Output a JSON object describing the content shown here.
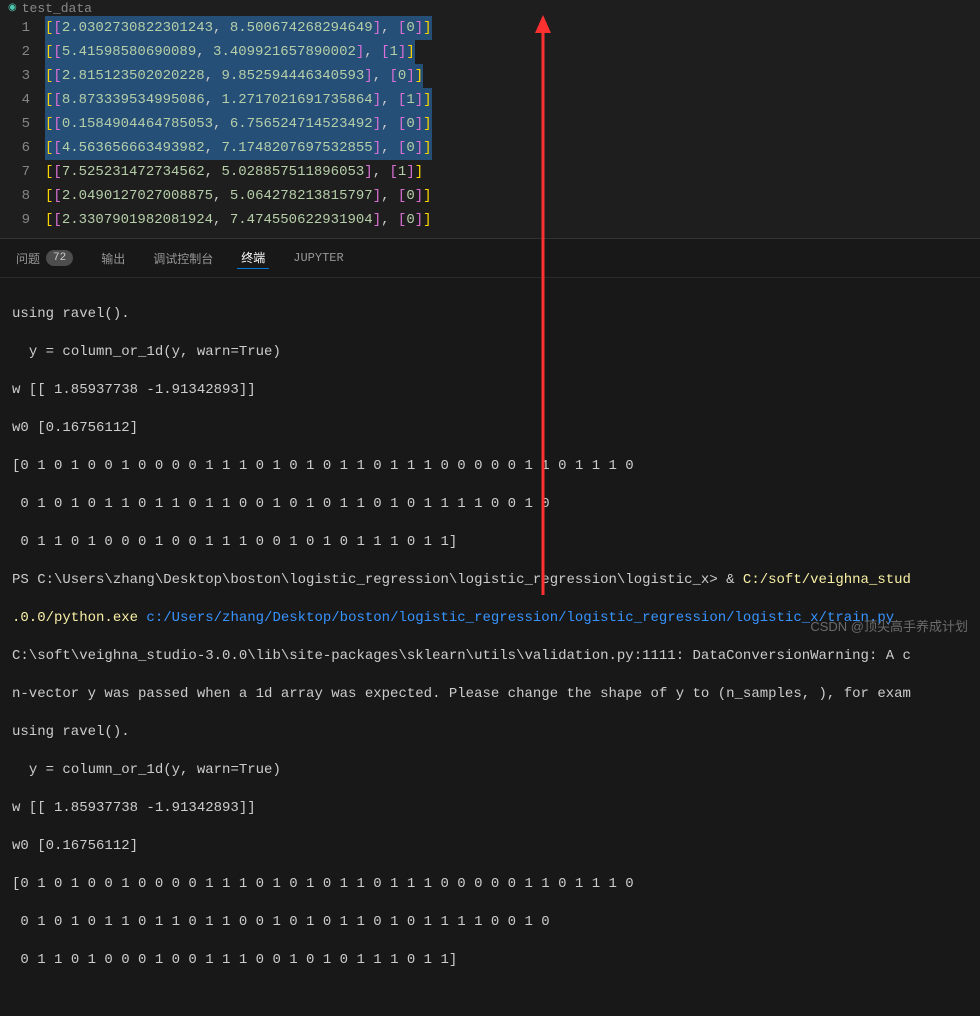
{
  "tab_title": "test_data",
  "lines": [
    {
      "num": 1,
      "sel": true,
      "a": "2.0302730822301243",
      "b": "8.500674268294649",
      "label": "0"
    },
    {
      "num": 2,
      "sel": true,
      "a": "5.41598580690089",
      "b": "3.409921657890002",
      "label": "1"
    },
    {
      "num": 3,
      "sel": true,
      "a": "2.815123502020228",
      "b": "9.852594446340593",
      "label": "0"
    },
    {
      "num": 4,
      "sel": true,
      "a": "8.873339534995086",
      "b": "1.2717021691735864",
      "label": "1"
    },
    {
      "num": 5,
      "sel": true,
      "a": "0.1584904464785053",
      "b": "6.756524714523492",
      "label": "0"
    },
    {
      "num": 6,
      "sel": true,
      "a": "4.563656663493982",
      "b": "7.1748207697532855",
      "label": "0"
    },
    {
      "num": 7,
      "sel": false,
      "a": "7.525231472734562",
      "b": "5.028857511896053",
      "label": "1"
    },
    {
      "num": 8,
      "sel": false,
      "a": "2.0490127027008875",
      "b": "5.064278213815797",
      "label": "0"
    },
    {
      "num": 9,
      "sel": false,
      "a": "2.3307901982081924",
      "b": "7.474550622931904",
      "label": "0"
    }
  ],
  "panel": {
    "tabs": {
      "problems": "问题",
      "output": "输出",
      "debug": "调试控制台",
      "terminal": "终端",
      "jupyter": "JUPYTER"
    },
    "badge": "72"
  },
  "terminal": {
    "l1": "using ravel().",
    "l2": "  y = column_or_1d(y, warn=True)",
    "l3": "w [[ 1.85937738 -1.91342893]]",
    "l4": "w0 [0.16756112]",
    "l5": "[0 1 0 1 0 0 1 0 0 0 0 1 1 1 0 1 0 1 0 1 1 0 1 1 1 0 0 0 0 0 1 1 0 1 1 1 0",
    "l6": " 0 1 0 1 0 1 1 0 1 1 0 1 1 0 0 1 0 1 0 1 1 0 1 0 1 1 1 1 0 0 1 0",
    "l7": " 0 1 1 0 1 0 0 0 1 0 0 1 1 1 0 0 1 0 1 0 1 1 1 0 1 1]",
    "l8a": "PS C:\\Users\\zhang\\Desktop\\boston\\logistic_regression\\logistic_regression\\logistic_x> & ",
    "l8b": "C:/soft/veighna_stud",
    "l9a": ".0.0/python.exe",
    "l9b": " c:/Users/zhang/Desktop/boston/logistic_regression/logistic_regression/logistic_x/train.py",
    "l10": "C:\\soft\\veighna_studio-3.0.0\\lib\\site-packages\\sklearn\\utils\\validation.py:1111: DataConversionWarning: A c",
    "l11": "n-vector y was passed when a 1d array was expected. Please change the shape of y to (n_samples, ), for exam",
    "l12": "using ravel().",
    "l13": "  y = column_or_1d(y, warn=True)",
    "l14": "w [[ 1.85937738 -1.91342893]]",
    "l15": "w0 [0.16756112]",
    "l16": "[0 1 0 1 0 0 1 0 0 0 0 1 1 1 0 1 0 1 0 1 1 0 1 1 1 0 0 0 0 0 1 1 0 1 1 1 0",
    "l17": " 0 1 0 1 0 1 1 0 1 1 0 1 1 0 0 1 0 1 0 1 1 0 1 0 1 1 1 1 0 0 1 0",
    "l18": " 0 1 1 0 1 0 0 0 1 0 0 1 1 1 0 0 1 0 1 0 1 1 1 0 1 1]"
  },
  "watermark": "CSDN @顶尖高手养成计划"
}
